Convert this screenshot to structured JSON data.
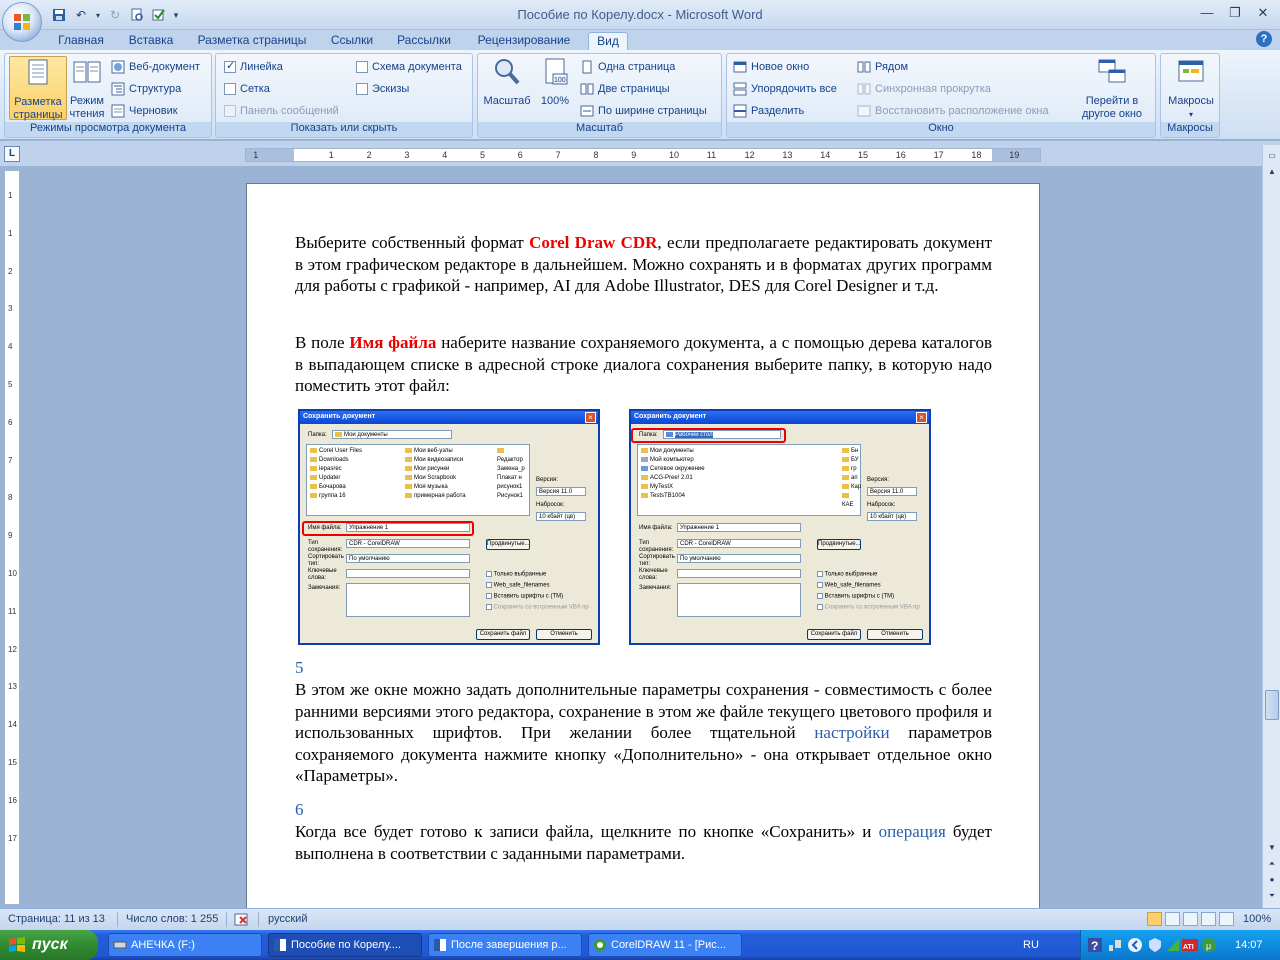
{
  "window": {
    "title": "Пособие по Корелу.docx - Microsoft Word"
  },
  "tabs": [
    "Главная",
    "Вставка",
    "Разметка страницы",
    "Ссылки",
    "Рассылки",
    "Рецензирование",
    "Вид"
  ],
  "active_tab": "Вид",
  "ribbon": {
    "views": {
      "label": "Режимы просмотра документа",
      "page_layout": "Разметка страницы",
      "reading": "Режим чтения",
      "web": "Веб-документ",
      "outline": "Структура",
      "draft": "Черновик"
    },
    "show": {
      "label": "Показать или скрыть",
      "ruler": "Линейка",
      "grid": "Сетка",
      "message_bar": "Панель сообщений",
      "doc_map": "Схема документа",
      "thumbnails": "Эскизы"
    },
    "zoom": {
      "label": "Масштаб",
      "zoom": "Масштаб",
      "hundred": "100%",
      "one_page": "Одна страница",
      "two_pages": "Две страницы",
      "page_width": "По ширине страницы"
    },
    "window": {
      "label": "Окно",
      "new_window": "Новое окно",
      "arrange_all": "Упорядочить все",
      "split": "Разделить",
      "side_by_side": "Рядом",
      "sync_scroll": "Синхронная прокрутка",
      "reset_pos": "Восстановить расположение окна",
      "switch_windows": "Перейти в другое окно"
    },
    "macros": {
      "label": "Макросы",
      "macros": "Макросы"
    }
  },
  "ruler": {
    "ticks": [
      "1",
      "1",
      "2",
      "3",
      "4",
      "5",
      "6",
      "7",
      "8",
      "9",
      "10",
      "11",
      "12",
      "13",
      "14",
      "15",
      "16",
      "17",
      "18",
      "19"
    ],
    "corner": "L",
    "vticks": [
      "1",
      "1",
      "2",
      "3",
      "4",
      "5",
      "6",
      "7",
      "8",
      "9",
      "10",
      "11",
      "12",
      "13",
      "14",
      "15",
      "16",
      "17"
    ]
  },
  "document": {
    "p1": {
      "a": "Выберите собственный формат ",
      "b": "Corel Draw CDR",
      "c": ", если предполагаете редактировать документ в этом графическом редакторе в дальнейшем. Можно сохранять и в форматах других программ для работы с графикой - например, AI для Adobe Illustrator, DES для Corel Designer и т.д."
    },
    "p2": {
      "a": "В поле ",
      "b": "Имя файла",
      "c": " наберите название сохраняемого документа, а с помощью дерева каталогов в выпадающем списке в адресной строке диалога сохранения выберите папку, в которую надо поместить этот файл:"
    },
    "n5": "5",
    "p3": {
      "a": "В этом же окне можно задать дополнительные параметры сохранения - совместимость с более ранними версиями этого редактора, сохранение в этом же файле текущего цветового профиля и использованных шрифтов. При желании более тщательной ",
      "link": "настройки",
      "c": " параметров сохраняемого документа нажмите кнопку «Дополнительно» - она открывает отдельное окно «Параметры»."
    },
    "n6": "6",
    "p4": {
      "a": "Когда все будет готово к записи файла, щелкните по кнопке «Сохранить» и ",
      "link": "операция",
      "c": " будет выполнена в соответствии с заданными параметрами."
    }
  },
  "dialog1": {
    "title": "Сохранить документ",
    "folder_label": "Папка:",
    "folder": "Мои документы",
    "files_col1": [
      "Corel User Files",
      "Downloads",
      "iepasrec",
      "Updater",
      "Бочарова",
      "группа 16"
    ],
    "files_col2": [
      "Мои веб-узлы",
      "Мои видеозаписи",
      "Мои рисунки",
      "Мои Scrapbook",
      "Моя музыка",
      "примерная работа"
    ],
    "files_col3": [
      "Редактор",
      "Замена_р",
      "Плакат н",
      "рисунок1",
      "Рисунок1"
    ],
    "version_label": "Версия:",
    "version": "Версия 11.0",
    "thumb_label": "Набросок:",
    "thumb": "10 кбайт (цв)",
    "filename_label": "Имя файла:",
    "filename": "Упражнение 1",
    "type_label": "Тип сохранения:",
    "type": "CDR - CorelDRAW",
    "sort_label": "Сортировать тип:",
    "sort": "По умолчанию",
    "keywords_label": "Ключевые слова:",
    "notes_label": "Замечания:",
    "advanced": "Продвинутые...",
    "opt1": "Только выбранные",
    "opt2": "Web_safe_filenames",
    "opt3": "Вставить шрифты с (TM)",
    "opt4": "Сохранить со встроенным VBA пр",
    "save": "Сохранить файл",
    "cancel": "Отменить"
  },
  "dialog2": {
    "title": "Сохранить документ",
    "folder_label": "Папка:",
    "folder": "Рабочий стол",
    "files_col1": [
      "Мои документы",
      "Мой компьютер",
      "Сетевое окружение",
      "ACG-Pree! 2.01",
      "MyTestX",
      "TestsTB1004"
    ],
    "files_col3": [
      "Бн",
      "БУ",
      "гр",
      "ап",
      "Кар",
      "КАЕ"
    ],
    "version_label": "Версия:",
    "version": "Версия 11.0",
    "thumb_label": "Набросок:",
    "thumb": "10 кбайт (цв)",
    "filename_label": "Имя файла:",
    "filename": "Упражнение 1",
    "type_label": "Тип сохранения:",
    "type": "CDR - CorelDRAW",
    "sort_label": "Сортировать тип:",
    "sort": "По умолчанию",
    "keywords_label": "Ключевые слова:",
    "notes_label": "Замечания:",
    "advanced": "Продвинутые...",
    "opt1": "Только выбранные",
    "opt2": "Web_safe_filenames",
    "opt3": "Вставить шрифты с (TM)",
    "opt4": "Сохранить со встроенным VBA пр",
    "save": "Сохранить файл",
    "cancel": "Отменить"
  },
  "status": {
    "page": "Страница: 11 из 13",
    "words": "Число слов: 1 255",
    "lang": "русский",
    "zoom": "100%"
  },
  "taskbar": {
    "start": "пуск",
    "tasks": [
      "АНЕЧКА (F:)",
      "Пособие по Корелу....",
      "После завершения р...",
      "CorelDRAW 11 - [Рис..."
    ],
    "lang": "RU",
    "time": "14:07"
  },
  "colors": {
    "ribbon_text": "#15428b",
    "accent_red": "#e00000",
    "link_blue": "#2a5ea8"
  }
}
